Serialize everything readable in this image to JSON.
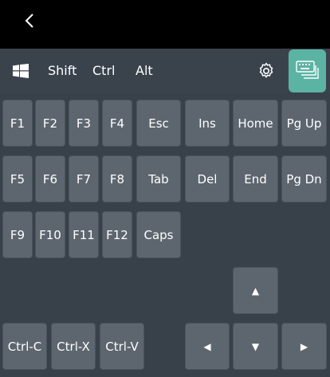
{
  "toolbar": {
    "shift": "Shift",
    "ctrl": "Ctrl",
    "alt": "Alt"
  },
  "keys": {
    "f1": "F1",
    "f2": "F2",
    "f3": "F3",
    "f4": "F4",
    "esc": "Esc",
    "ins": "Ins",
    "home": "Home",
    "pgup": "Pg Up",
    "f5": "F5",
    "f6": "F6",
    "f7": "F7",
    "f8": "F8",
    "tab": "Tab",
    "del": "Del",
    "end": "End",
    "pgdn": "Pg Dn",
    "f9": "F9",
    "f10": "F10",
    "f11": "F11",
    "f12": "F12",
    "caps": "Caps",
    "ctrlc": "Ctrl-C",
    "ctrlx": "Ctrl-X",
    "ctrlv": "Ctrl-V",
    "up": "▲",
    "left": "◀",
    "down": "▼",
    "right": "▶"
  },
  "icons": {
    "back": "back-chevron-icon",
    "windows": "windows-icon",
    "settings": "gear-icon",
    "keyboard": "keyboard-icon"
  },
  "colors": {
    "accent": "#5bb3a3",
    "key": "#5d666f",
    "background": "#38414a"
  }
}
